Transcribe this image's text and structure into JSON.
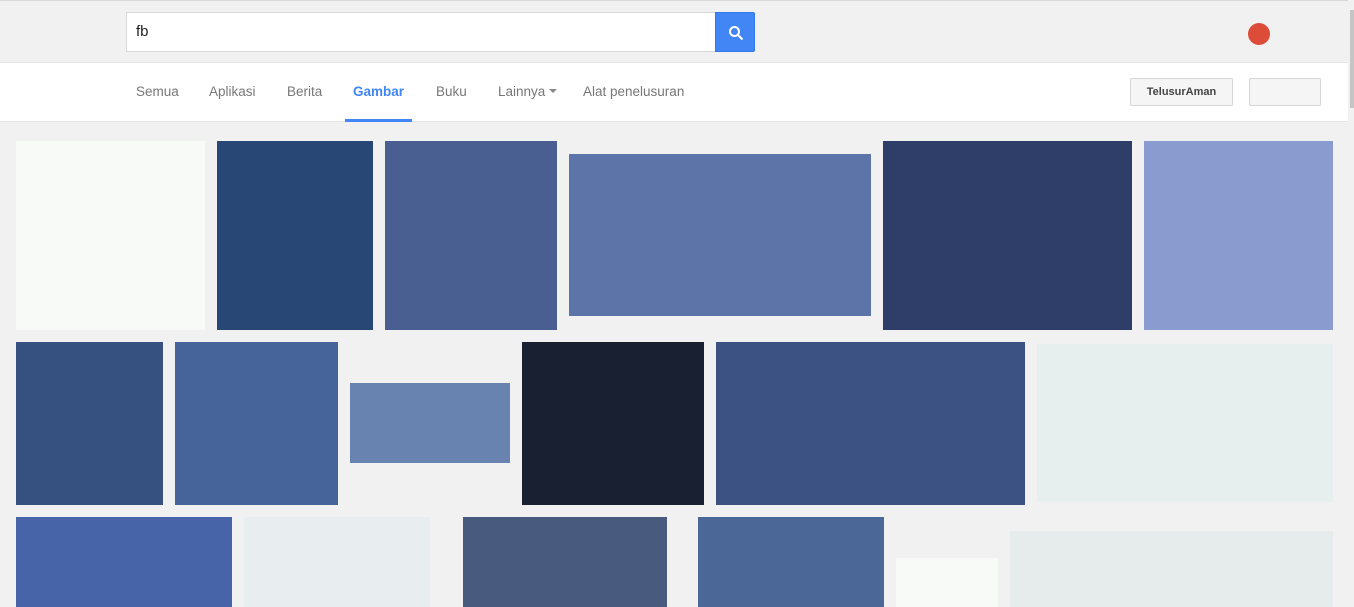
{
  "search": {
    "query": "fb"
  },
  "nav": {
    "tabs": [
      {
        "label": "Semua",
        "active": false
      },
      {
        "label": "Aplikasi",
        "active": false
      },
      {
        "label": "Berita",
        "active": false
      },
      {
        "label": "Gambar",
        "active": true
      },
      {
        "label": "Buku",
        "active": false
      },
      {
        "label": "Lainnya",
        "active": false
      },
      {
        "label": "Alat penelusuran",
        "active": false
      }
    ],
    "safe_search_label": "TelusurAman"
  },
  "colors": {
    "accent": "#4285f4",
    "avatar": "#dd4b39"
  },
  "image_colors": [
    "#f8faf8",
    "#294775",
    "#4a5f91",
    "#5c74a8",
    "#2f3d69",
    "#8a9ccf",
    "#36507f",
    "#46639a",
    "#6983b1",
    "#182032",
    "#3b5282",
    "#e6eeee",
    "#4664a7",
    "#e8edf0",
    "#485b7e",
    "#4b6798",
    "#f8faf8",
    "#e6eceb"
  ]
}
